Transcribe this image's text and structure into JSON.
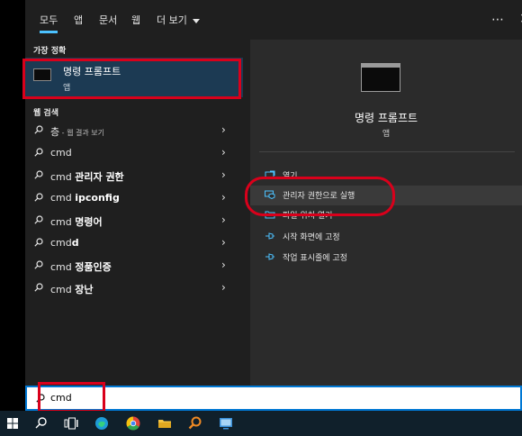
{
  "tabs": [
    {
      "label": "모두",
      "active": true
    },
    {
      "label": "앱"
    },
    {
      "label": "문서"
    },
    {
      "label": "웹"
    },
    {
      "label": "더 보기"
    }
  ],
  "left": {
    "best_match_title": "가장 정확",
    "best_match": {
      "name": "명령 프롬프트",
      "type": "앱"
    },
    "web_title": "웹 검색",
    "web_results": [
      {
        "prefix": "층",
        "rest": " - 웹 결과 보기"
      },
      {
        "prefix": "cmd",
        "rest": ""
      },
      {
        "prefix": "cmd ",
        "rest": "관리자 권한"
      },
      {
        "prefix": "cmd ",
        "rest": "ipconfig"
      },
      {
        "prefix": "cmd ",
        "rest": "명령어"
      },
      {
        "prefix": "cmd",
        "rest": "d"
      },
      {
        "prefix": "cmd ",
        "rest": "정품인증"
      },
      {
        "prefix": "cmd ",
        "rest": "장난"
      }
    ]
  },
  "right": {
    "title": "명령 프롬프트",
    "subtitle": "앱",
    "actions": [
      {
        "label": "열기",
        "icon": "open-icon"
      },
      {
        "label": "관리자 권한으로 실행",
        "icon": "shield-icon"
      },
      {
        "label": "파일 위치 열기",
        "icon": "folder-icon"
      },
      {
        "label": "시작 화면에 고정",
        "icon": "pin-icon"
      },
      {
        "label": "작업 표시줄에 고정",
        "icon": "pin-icon"
      }
    ]
  },
  "search": {
    "value": "cmd"
  },
  "taskbar_icons": [
    "windows-start-icon",
    "search-icon",
    "task-view-icon",
    "edge-icon",
    "chrome-icon",
    "file-explorer-icon",
    "search-app-icon",
    "remote-desktop-icon"
  ],
  "colors": {
    "accent": "#4cc2ff",
    "highlight_box": "#d9001b",
    "selected_bg": "#1c3a53",
    "taskbar_bg": "#10202b"
  }
}
